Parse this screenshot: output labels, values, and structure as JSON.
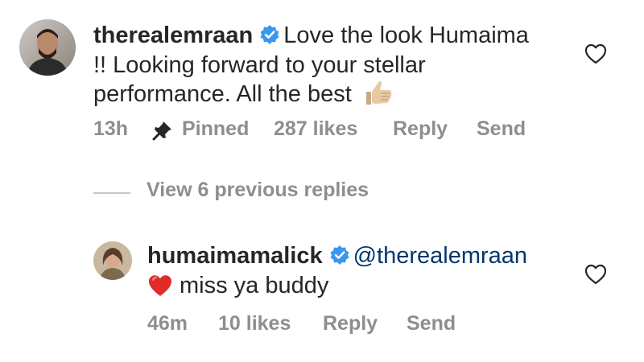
{
  "comment": {
    "username": "therealemraan",
    "text_line1": "Love the look Humaima",
    "text_line2": "!! Looking forward to your stellar",
    "text_line3": "performance. All the best",
    "emoji": "thumbs-up",
    "time": "13h",
    "pinned_label": "Pinned",
    "likes": "287 likes",
    "reply_label": "Reply",
    "send_label": "Send"
  },
  "view_replies": {
    "label": "View 6 previous replies"
  },
  "reply": {
    "username": "humaimamalick",
    "mention": "@therealemraan",
    "emoji": "red-heart",
    "text": "miss ya buddy",
    "time": "46m",
    "likes": "10 likes",
    "reply_label": "Reply",
    "send_label": "Send"
  },
  "colors": {
    "text": "#262626",
    "muted": "#8e8e8e",
    "mention": "#00376b",
    "verified": "#3897f0"
  }
}
